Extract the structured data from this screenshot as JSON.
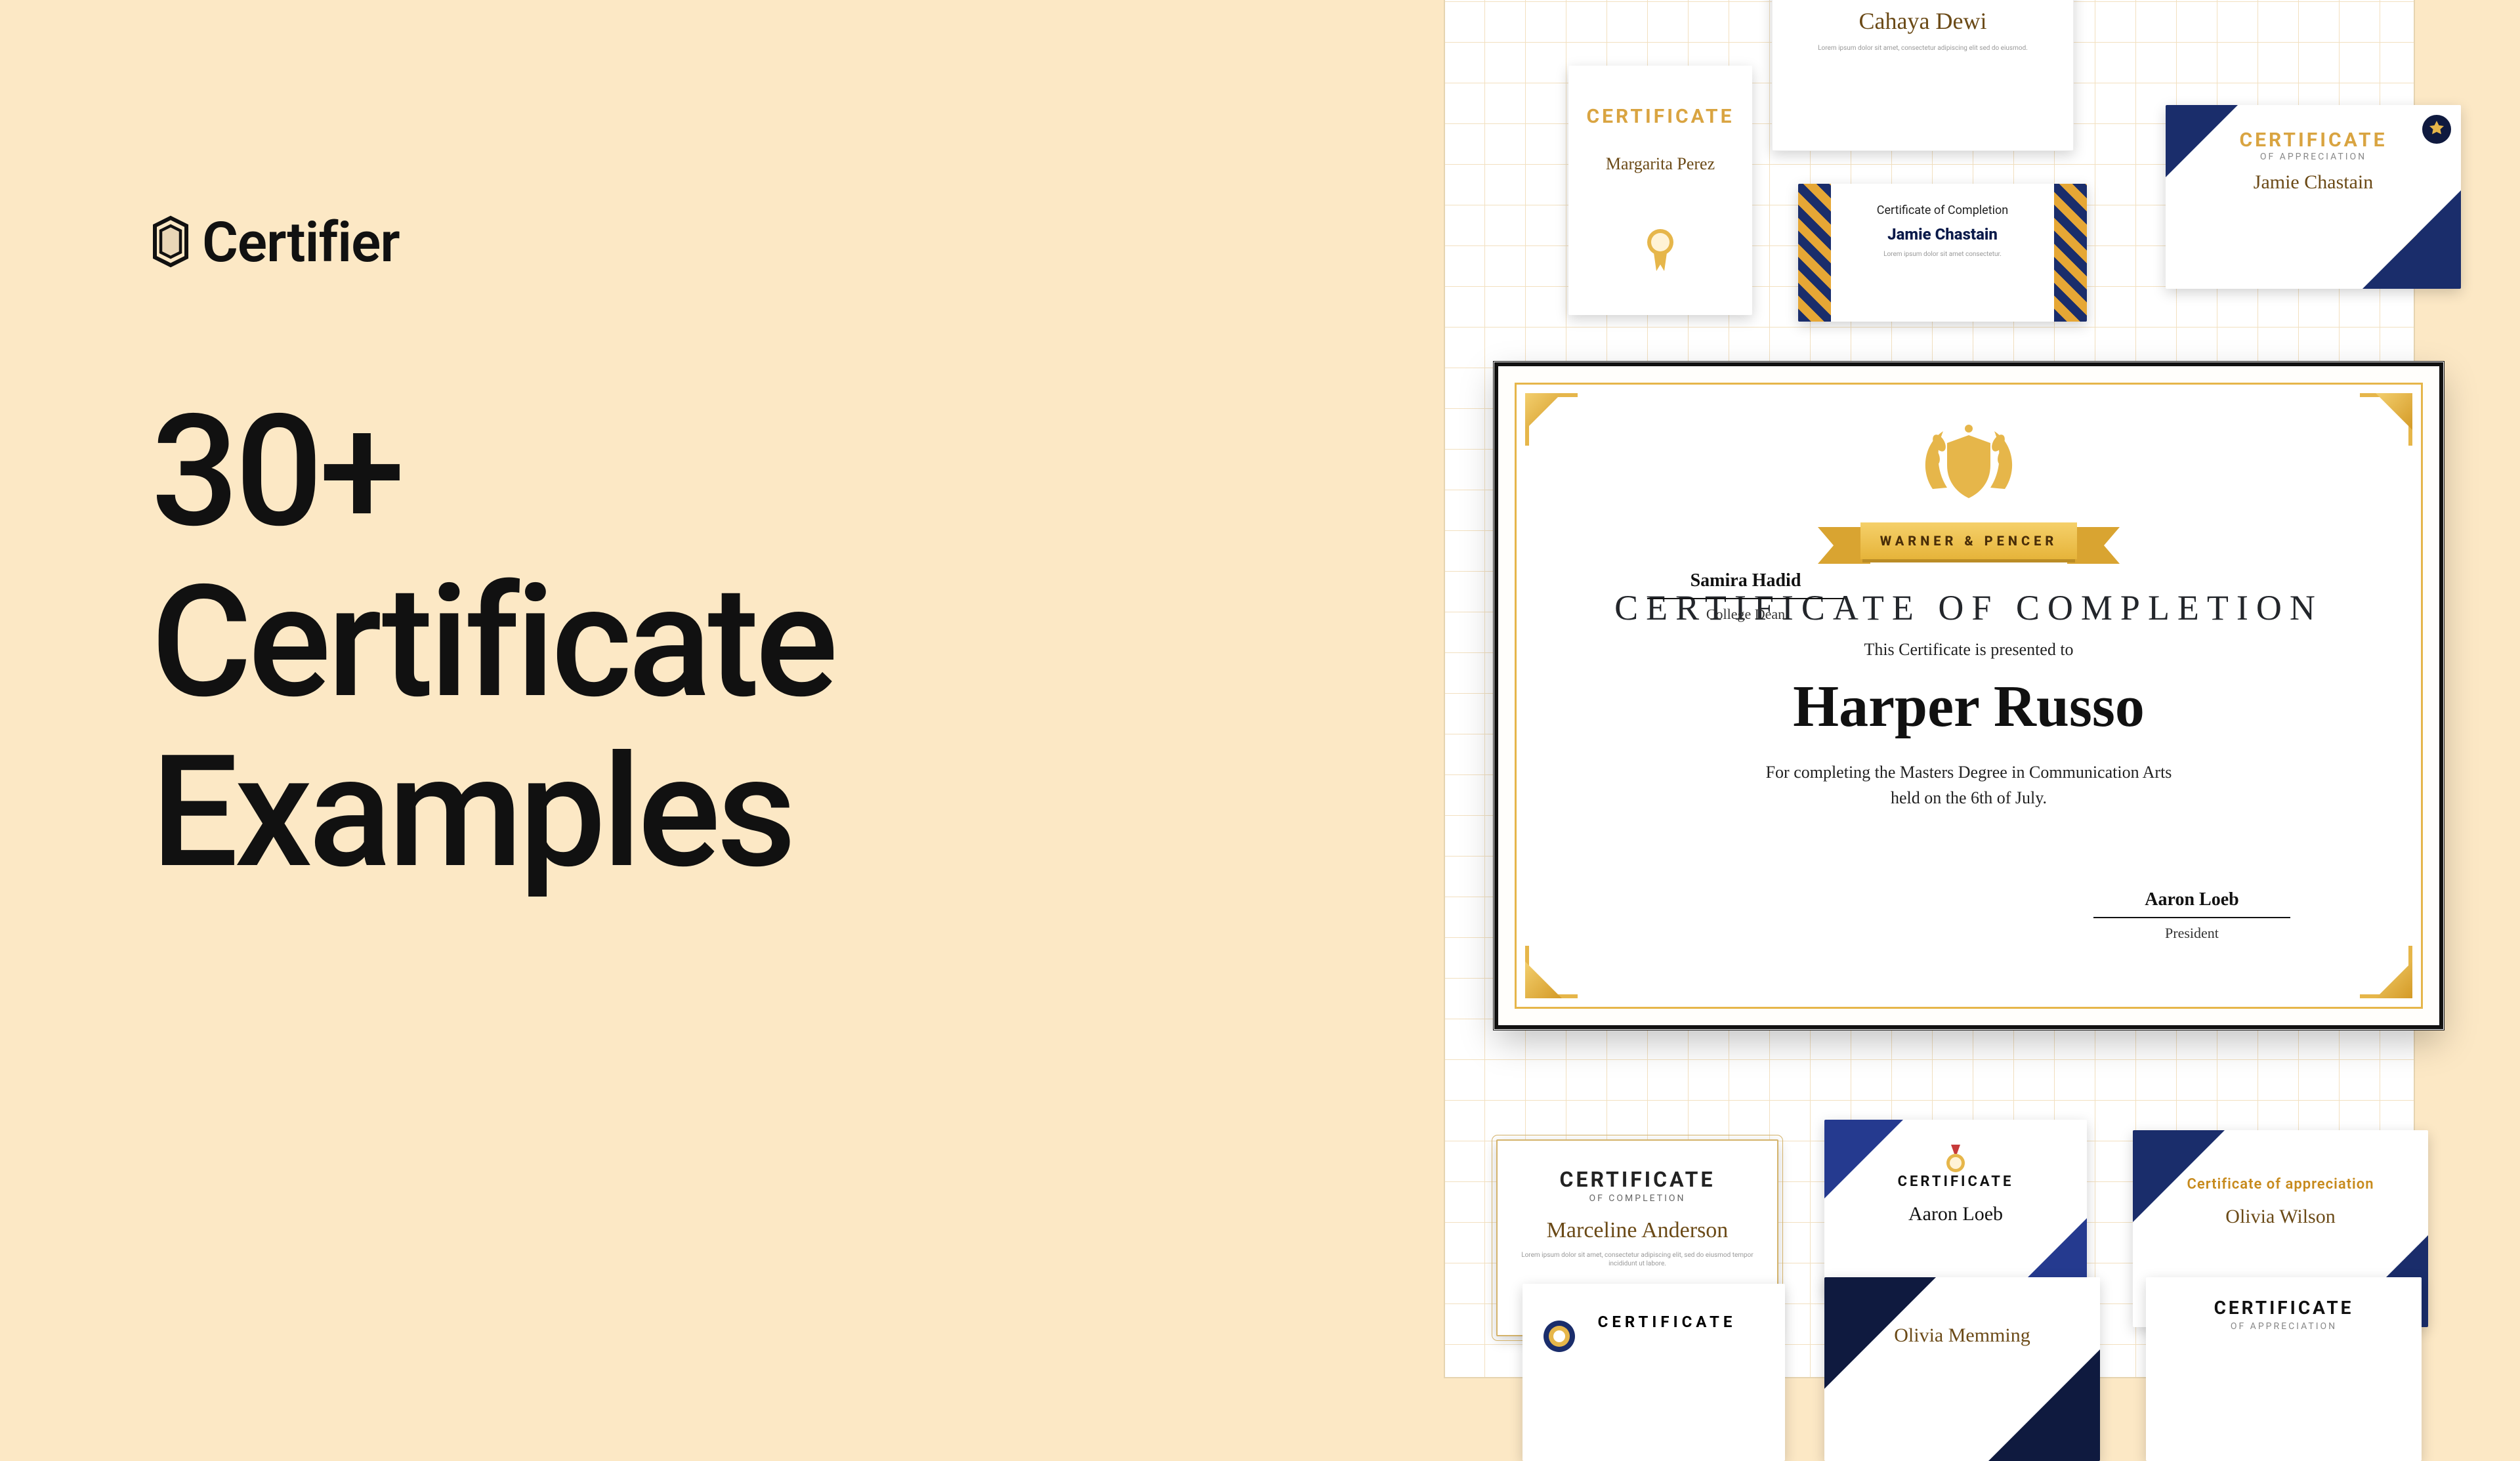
{
  "brand": {
    "name": "Certifier"
  },
  "headline": {
    "line1": "30+",
    "line2": "Certificate",
    "line3": "Examples"
  },
  "feature": {
    "org": "WARNER & PENCER",
    "title": "CERTIFICATE OF COMPLETION",
    "presented": "This Certificate is presented to",
    "recipient": "Harper Russo",
    "reason_line1": "For completing the Masters Degree in Communication Arts",
    "reason_line2": "held on the 6th of July.",
    "sig_left": {
      "name": "Samira Hadid",
      "role": "College Dean"
    },
    "sig_right": {
      "name": "Aaron Loeb",
      "role": "President"
    }
  },
  "thumbs": {
    "t1": {
      "title": "CERTIFICATE",
      "name": "Margarita Perez"
    },
    "top_center": {
      "name": "Cahaya Dewi"
    },
    "t2": {
      "sub": "Certificate of Completion",
      "name": "Jamie Chastain"
    },
    "t3": {
      "title": "CERTIFICATE",
      "sub": "OF APPRECIATION",
      "name": "Jamie Chastain"
    },
    "b1": {
      "title": "CERTIFICATE",
      "sub": "OF COMPLETION",
      "name": "Marceline Anderson"
    },
    "b2": {
      "title": "CERTIFICATE",
      "name": "Aaron Loeb"
    },
    "b3": {
      "title": "Certificate of appreciation",
      "name": "Olivia Wilson"
    },
    "p1": {
      "title": "CERTIFICATE"
    },
    "p2": {
      "name": "Olivia Memming"
    },
    "p3": {
      "title": "CERTIFICATE",
      "sub": "OF APPRECIATION"
    }
  }
}
